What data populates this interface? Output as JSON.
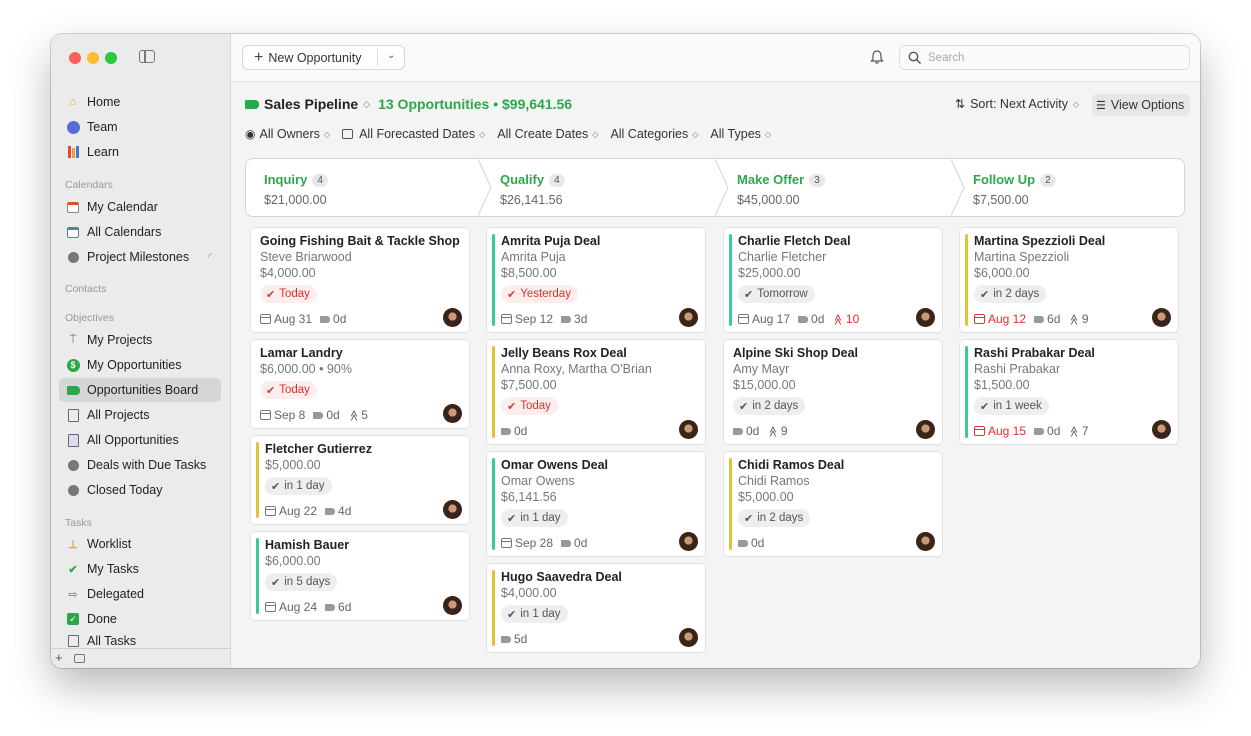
{
  "window": {
    "traffic_colors": [
      "#fe5f57",
      "#febc2e",
      "#28c840"
    ]
  },
  "sidebar": {
    "items_top": [
      {
        "label": "Home",
        "icon": "house-icon"
      },
      {
        "label": "Team",
        "icon": "team-icon"
      },
      {
        "label": "Learn",
        "icon": "books-icon"
      }
    ],
    "calendars_header": "Calendars",
    "calendars": [
      {
        "label": "My Calendar",
        "icon": "calendar-icon"
      },
      {
        "label": "All Calendars",
        "icon": "calendar-grid-icon"
      },
      {
        "label": "Project Milestones",
        "icon": "milestones-icon"
      }
    ],
    "contacts_header": "Contacts",
    "objectives_header": "Objectives",
    "objectives": [
      {
        "label": "My Projects",
        "icon": "pin-icon"
      },
      {
        "label": "My Opportunities",
        "icon": "dollar-icon"
      },
      {
        "label": "Opportunities Board",
        "icon": "tag-icon",
        "active": true
      },
      {
        "label": "All Projects",
        "icon": "projects-icon"
      },
      {
        "label": "All Opportunities",
        "icon": "opportunities-icon"
      },
      {
        "label": "Deals with Due Tasks",
        "icon": "deals-icon"
      },
      {
        "label": "Closed Today",
        "icon": "closed-icon"
      }
    ],
    "tasks_header": "Tasks",
    "tasks": [
      {
        "label": "Worklist",
        "icon": "pushpin-icon"
      },
      {
        "label": "My Tasks",
        "icon": "checkmark-icon"
      },
      {
        "label": "Delegated",
        "icon": "arrow-right-icon"
      },
      {
        "label": "Done",
        "icon": "done-icon"
      },
      {
        "label": "All Tasks",
        "icon": "all-tasks-icon"
      }
    ],
    "bottom_plus": "+"
  },
  "toolbar": {
    "new_label": "New Opportunity",
    "search_placeholder": "Search"
  },
  "header": {
    "title": "Sales Pipeline",
    "summary": "13 Opportunities • $99,641.56",
    "sort_label": "Sort: Next Activity",
    "view_options": "View Options",
    "accent": "#2ba84a"
  },
  "filters": [
    "All Owners",
    "All Forecasted Dates",
    "All Create Dates",
    "All Categories",
    "All Types"
  ],
  "stages": [
    {
      "name": "Inquiry",
      "count": "4",
      "amount": "$21,000.00"
    },
    {
      "name": "Qualify",
      "count": "4",
      "amount": "$26,141.56"
    },
    {
      "name": "Make Offer",
      "count": "3",
      "amount": "$45,000.00"
    },
    {
      "name": "Follow Up",
      "count": "2",
      "amount": "$7,500.00"
    }
  ],
  "columns": [
    [
      {
        "title": "Going Fishing Bait & Tackle Shop",
        "lines": [
          "Steve Briarwood",
          "$4,000.00"
        ],
        "pill": "Today",
        "pill_red": true,
        "date": "Aug 31",
        "tag": "0d"
      },
      {
        "title": "Lamar Landry",
        "lines": [
          "$6,000.00 • 90%"
        ],
        "pill": "Today",
        "pill_red": true,
        "date": "Sep 8",
        "tag": "0d",
        "prio": "5"
      },
      {
        "title": "Fletcher Gutierrez",
        "lines": [
          "$5,000.00"
        ],
        "pill": "in 1 day",
        "date": "Aug 22",
        "tag": "4d",
        "bar": "#e2c23a"
      },
      {
        "title": "Hamish Bauer",
        "lines": [
          "$6,000.00"
        ],
        "pill": "in 5 days",
        "date": "Aug 24",
        "tag": "6d",
        "bar": "#3ec99a"
      }
    ],
    [
      {
        "title": "Amrita Puja Deal",
        "lines": [
          "Amrita Puja",
          "$8,500.00"
        ],
        "pill": "Yesterday",
        "pill_red": true,
        "date": "Sep 12",
        "tag": "3d",
        "bar": "#3ec99a"
      },
      {
        "title": "Jelly Beans Rox Deal",
        "lines": [
          "Anna Roxy, Martha O'Brian",
          "$7,500.00"
        ],
        "pill": "Today",
        "pill_red": true,
        "tag": "0d",
        "bar": "#e2c23a"
      },
      {
        "title": "Omar Owens Deal",
        "lines": [
          "Omar Owens",
          "$6,141.56"
        ],
        "pill": "in 1 day",
        "date": "Sep 28",
        "tag": "0d",
        "bar": "#3ec99a"
      },
      {
        "title": "Hugo Saavedra Deal",
        "lines": [
          "$4,000.00"
        ],
        "pill": "in 1 day",
        "tag": "5d",
        "bar": "#e2c23a"
      }
    ],
    [
      {
        "title": "Charlie Fletch Deal",
        "lines": [
          "Charlie Fletcher",
          "$25,000.00"
        ],
        "pill": "Tomorrow",
        "date": "Aug 17",
        "tag": "0d",
        "prio": "10",
        "prio_red": true,
        "bar": "#3ec99a"
      },
      {
        "title": "Alpine Ski Shop Deal",
        "lines": [
          "Amy Mayr",
          "$15,000.00"
        ],
        "pill": "in 2 days",
        "tag": "0d",
        "prio": "9"
      },
      {
        "title": "Chidi Ramos Deal",
        "lines": [
          "Chidi Ramos",
          "$5,000.00"
        ],
        "pill": "in 2 days",
        "tag": "0d",
        "bar": "#e2c23a"
      }
    ],
    [
      {
        "title": "Martina Spezzioli Deal",
        "lines": [
          "Martina Spezzioli",
          "$6,000.00"
        ],
        "pill": "in 2 days",
        "date": "Aug 12",
        "date_red": true,
        "tag": "6d",
        "prio": "9",
        "bar": "#e2c23a"
      },
      {
        "title": "Rashi Prabakar Deal",
        "lines": [
          "Rashi Prabakar",
          "$1,500.00"
        ],
        "pill": "in 1 week",
        "date": "Aug 15",
        "date_red": true,
        "tag": "0d",
        "prio": "7",
        "bar": "#3ec99a"
      }
    ]
  ]
}
